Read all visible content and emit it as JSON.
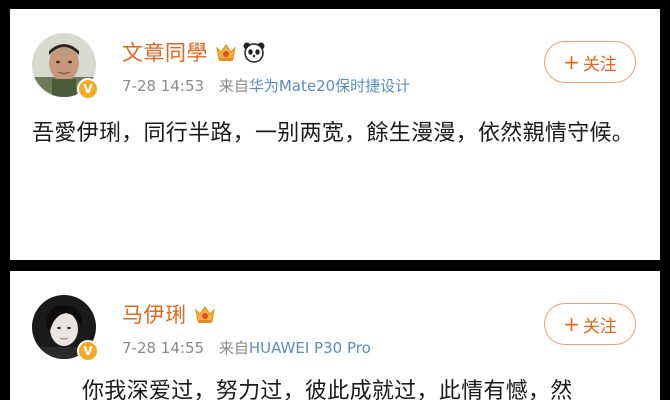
{
  "posts": [
    {
      "username": "文章同學",
      "badges": [
        "crown-icon",
        "panda-icon"
      ],
      "verified": true,
      "time": "7-28 14:53",
      "from_prefix": "来自",
      "source": "华为Mate20保时捷设计",
      "follow_label": "关注",
      "content": "吾愛伊琍，同行半路，一别两宽，餘生漫漫，依然親情守候。"
    },
    {
      "username": "马伊琍",
      "badges": [
        "crown-icon"
      ],
      "verified": true,
      "time": "7-28 14:55",
      "from_prefix": "来自",
      "source": "HUAWEI P30 Pro",
      "follow_label": "关注",
      "content": "你我深爱过，努力过，彼此成就过，此情有憾，然"
    }
  ],
  "colors": {
    "name": "#e8641b",
    "meta": "#8a8a8a",
    "source": "#5a8cc4",
    "follow_border": "#e9a07a",
    "verified_badge": "#f3a928"
  }
}
